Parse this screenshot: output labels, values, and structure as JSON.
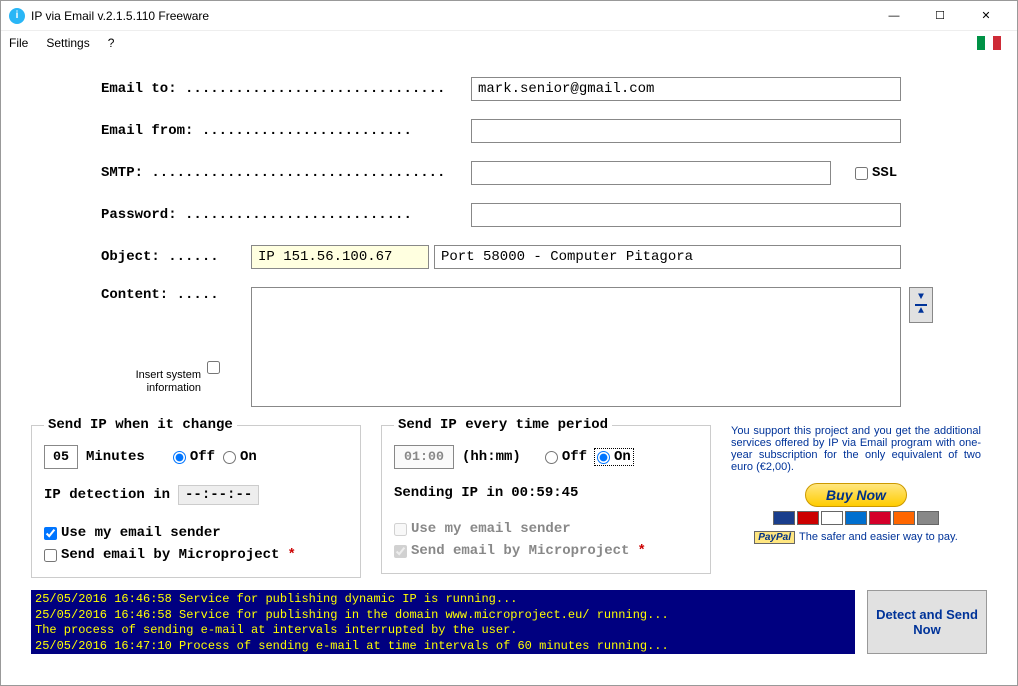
{
  "titlebar": {
    "title": "IP via Email v.2.1.5.110 Freeware"
  },
  "menu": {
    "file": "File",
    "settings": "Settings",
    "help": "?"
  },
  "form": {
    "email_to_label": "Email to: ...............................",
    "email_to_value": "mark.senior@gmail.com",
    "email_from_label": "Email from: .........................",
    "email_from_value": "",
    "smtp_label": "SMTP: ...................................",
    "smtp_value": "",
    "ssl_label": "SSL",
    "password_label": "Password: ...........................",
    "password_value": "",
    "object_label": "Object: ......",
    "object_ip": "IP 151.56.100.67",
    "object_port": "Port 58000 - Computer Pitagora",
    "content_label": "Content: .....",
    "content_value": "",
    "insert_sys_label": "Insert system information"
  },
  "group1": {
    "legend": "Send IP when it change",
    "minutes_value": "05",
    "minutes_label": "Minutes",
    "off": "Off",
    "on": "On",
    "detect_label": "IP detection in",
    "detect_value": "--:--:--",
    "use_sender": "Use my email sender",
    "send_mp": "Send email by Microproject"
  },
  "group2": {
    "legend": "Send IP every time period",
    "time_value": "01:00",
    "time_label": "(hh:mm)",
    "off": "Off",
    "on": "On",
    "sending_label": "Sending IP in",
    "sending_value": "00:59:45",
    "use_sender": "Use my email sender",
    "send_mp": "Send email by Microproject"
  },
  "support": {
    "text": "You support this project and you get the additional services offered by IP via Email program with one-year subscription for the only equivalent of two euro (€2,00).",
    "buy": "Buy Now",
    "safer": "The safer and easier way to pay.",
    "paypal": "PayPal"
  },
  "log": {
    "l1": "25/05/2016 16:46:58 Service for publishing dynamic IP is running...",
    "l2": "25/05/2016 16:46:58 Service for publishing in the domain www.microproject.eu/ running...",
    "l3": "The process of sending e-mail at intervals interrupted by the user.",
    "l4": "25/05/2016 16:47:10 Process of sending e-mail at time intervals of 60 minutes running..."
  },
  "detect_btn": "Detect and Send Now"
}
